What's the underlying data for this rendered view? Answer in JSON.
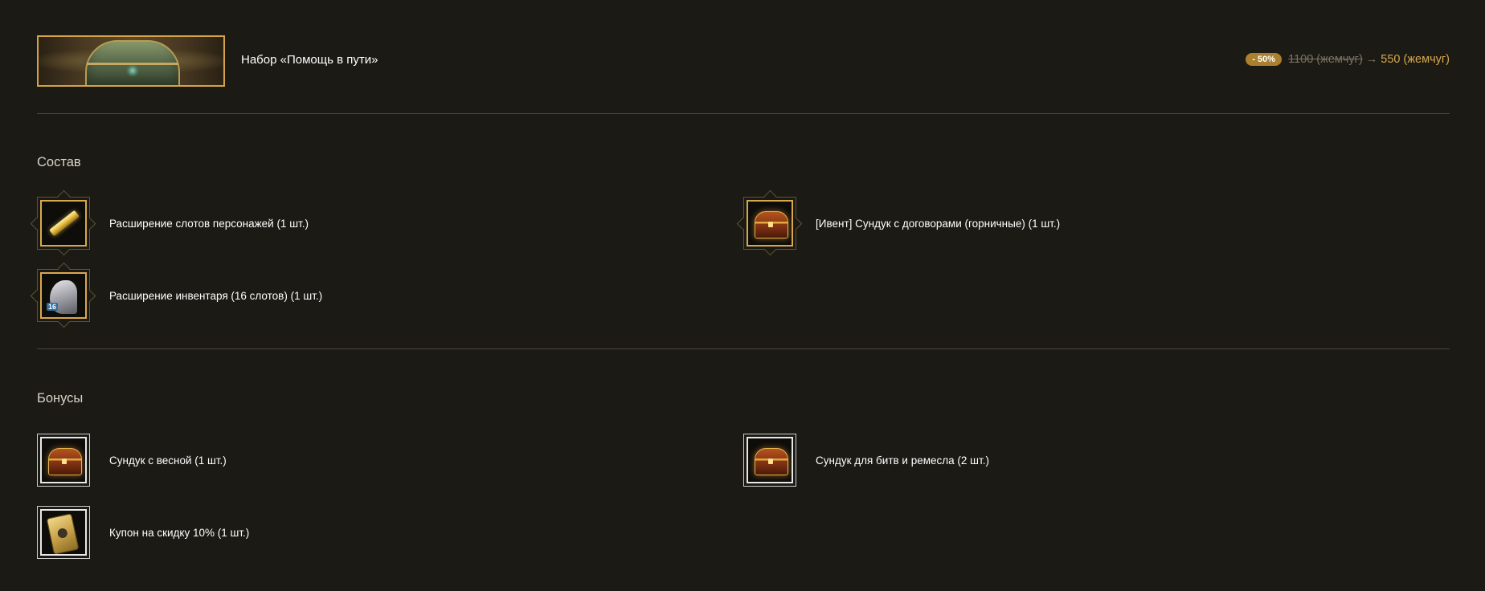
{
  "header": {
    "title": "Набор «Помощь в пути»",
    "price": {
      "discount": "- 50%",
      "old": "1100 (жемчуг)",
      "arrow": "→",
      "new": "550 (жемчуг)"
    }
  },
  "composition": {
    "title": "Состав",
    "items": [
      {
        "label": "Расширение слотов персонажей (1 шт.)",
        "icon": "character-slot-expansion-icon"
      },
      {
        "label": "[Ивент] Сундук с договорами (горничные) (1 шт.)",
        "icon": "chest-icon"
      },
      {
        "label": "Расширение инвентаря (16 слотов) (1 шт.)",
        "icon": "inventory-bag-icon",
        "badge": "16"
      }
    ]
  },
  "bonuses": {
    "title": "Бонусы",
    "items": [
      {
        "label": "Сундук с весной (1 шт.)",
        "icon": "chest-icon"
      },
      {
        "label": "Сундук для битв и ремесла (2 шт.)",
        "icon": "chest-icon"
      },
      {
        "label": "Купон на скидку 10% (1 шт.)",
        "icon": "coupon-icon"
      }
    ]
  },
  "colors": {
    "background": "#1b1a14",
    "accent_gold": "#d9a94f",
    "badge": "#a9802f"
  }
}
